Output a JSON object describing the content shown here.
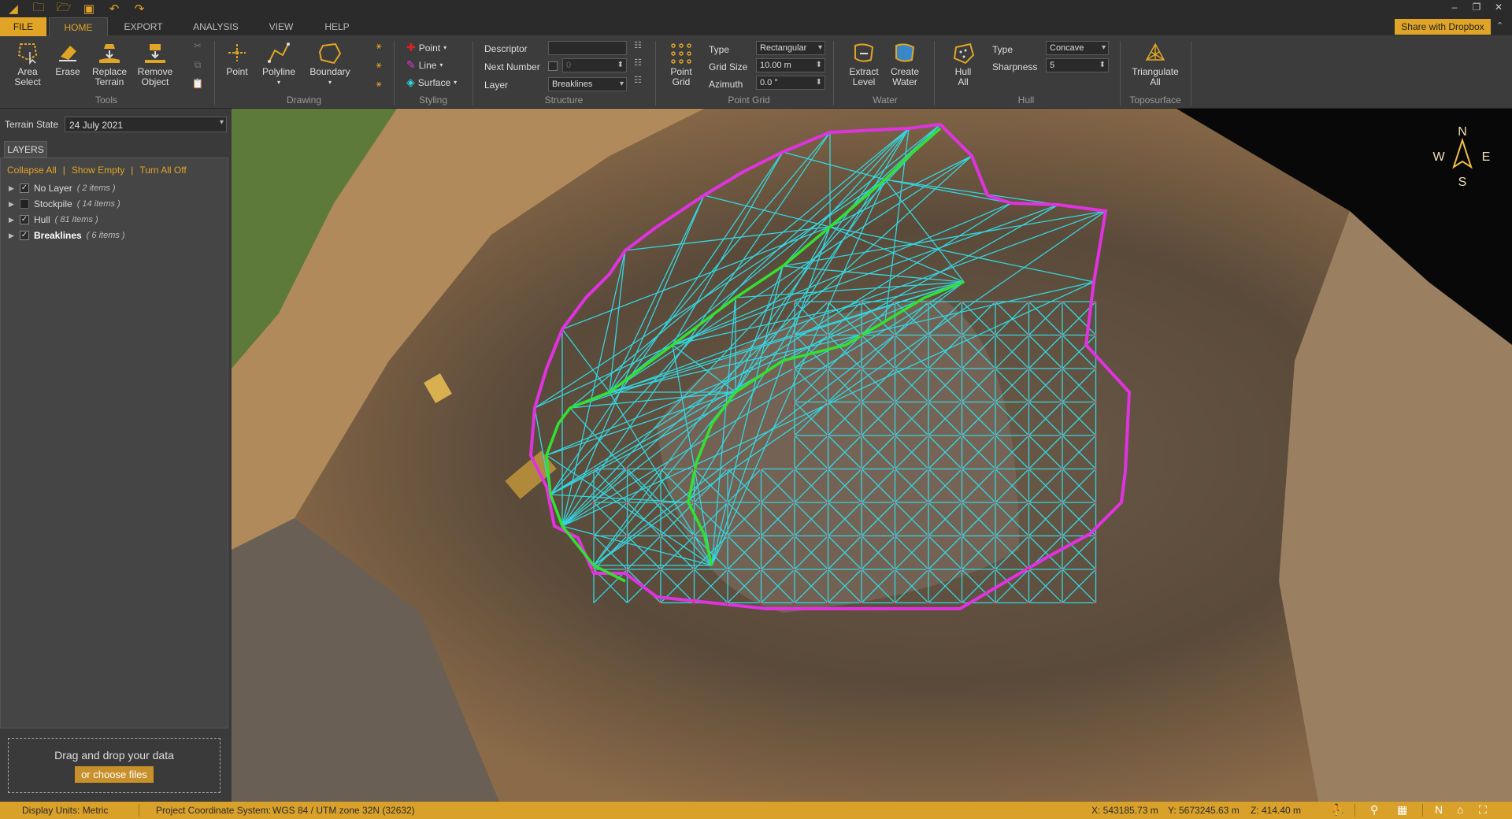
{
  "titlebar": {
    "quick_access": [
      "app-logo-icon",
      "new-folder-icon",
      "open-folder-icon",
      "save-icon",
      "undo-icon",
      "redo-icon"
    ],
    "window_controls": [
      "–",
      "❐",
      "✕"
    ]
  },
  "menu": {
    "tabs": [
      "FILE",
      "HOME",
      "EXPORT",
      "ANALYSIS",
      "VIEW",
      "HELP"
    ],
    "active": "HOME",
    "share_label": "Share with Dropbox"
  },
  "ribbon": {
    "tools": {
      "area_select": "Area\nSelect",
      "erase": "Erase",
      "replace_terrain": "Replace\nTerrain",
      "remove_object": "Remove\nObject",
      "group": "Tools"
    },
    "drawing": {
      "point": "Point",
      "polyline": "Polyline",
      "boundary": "Boundary",
      "group": "Drawing"
    },
    "styling": {
      "point": "Point",
      "line": "Line",
      "surface": "Surface",
      "group": "Styling"
    },
    "structure": {
      "descriptor_label": "Descriptor",
      "descriptor_value": "",
      "next_number_label": "Next Number",
      "next_number_value": "0",
      "layer_label": "Layer",
      "layer_value": "Breaklines",
      "group": "Structure"
    },
    "point_grid": {
      "button": "Point\nGrid",
      "type_label": "Type",
      "type_value": "Rectangular",
      "grid_size_label": "Grid Size",
      "grid_size_value": "10.00 m",
      "azimuth_label": "Azimuth",
      "azimuth_value": "0.0 °",
      "group": "Point Grid"
    },
    "water": {
      "extract_level": "Extract\nLevel",
      "create_water": "Create\nWater",
      "group": "Water"
    },
    "hull": {
      "hull_all": "Hull\nAll",
      "type_label": "Type",
      "type_value": "Concave",
      "sharpness_label": "Sharpness",
      "sharpness_value": "5",
      "group": "Hull"
    },
    "toposurface": {
      "triangulate_all": "Triangulate\nAll",
      "group": "Toposurface"
    }
  },
  "sidebar": {
    "terrain_state_label": "Terrain State",
    "terrain_state_value": "24 July 2021",
    "layers_tab": "LAYERS",
    "links": [
      "Collapse All",
      "Show Empty",
      "Turn All Off"
    ],
    "layers": [
      {
        "name": "No Layer",
        "count": "( 2 items )",
        "checked": true,
        "bold": false
      },
      {
        "name": "Stockpile",
        "count": "( 14 items )",
        "checked": false,
        "bold": false
      },
      {
        "name": "Hull",
        "count": "( 81 items )",
        "checked": true,
        "bold": false
      },
      {
        "name": "Breaklines",
        "count": "( 6 items )",
        "checked": true,
        "bold": true
      }
    ],
    "drop_text": "Drag and drop your data",
    "drop_button": "or choose files"
  },
  "compass": {
    "n": "N",
    "s": "S",
    "e": "E",
    "w": "W"
  },
  "colors": {
    "accent": "#e0a526",
    "hull": "#e033e0",
    "breakline": "#33e033",
    "triangulation": "#33d6e0",
    "grid_point": "#e02020"
  },
  "status": {
    "display_units": "Display Units: Metric",
    "coord_system_label": "Project Coordinate System:",
    "coord_system_value": "WGS 84 / UTM zone 32N (32632)",
    "x": "X: 543185.73 m",
    "y": "Y: 5673245.63 m",
    "z": "Z: 414.40 m",
    "icons": [
      "person-icon",
      "tree-icon",
      "grid-icon",
      "north-icon",
      "home-icon",
      "fullscreen-icon"
    ]
  }
}
